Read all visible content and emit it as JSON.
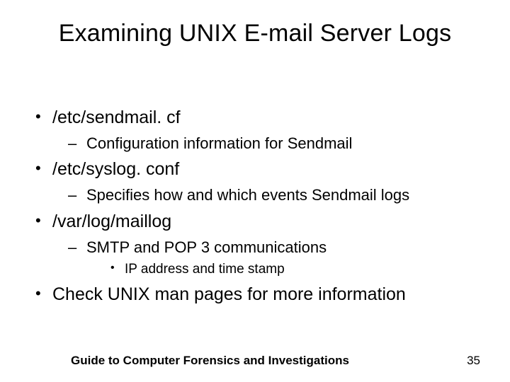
{
  "title": "Examining UNIX E-mail Server Logs",
  "bullets": {
    "b1": "/etc/sendmail. cf",
    "b1_1": "Configuration information for Sendmail",
    "b2": "/etc/syslog. conf",
    "b2_1": "Specifies how and which events Sendmail logs",
    "b3": "/var/log/maillog",
    "b3_1": "SMTP and POP 3 communications",
    "b3_1_1": "IP address and time stamp",
    "b4": "Check UNIX man pages for more information"
  },
  "footer": {
    "text": "Guide to Computer Forensics and Investigations",
    "number": "35"
  }
}
